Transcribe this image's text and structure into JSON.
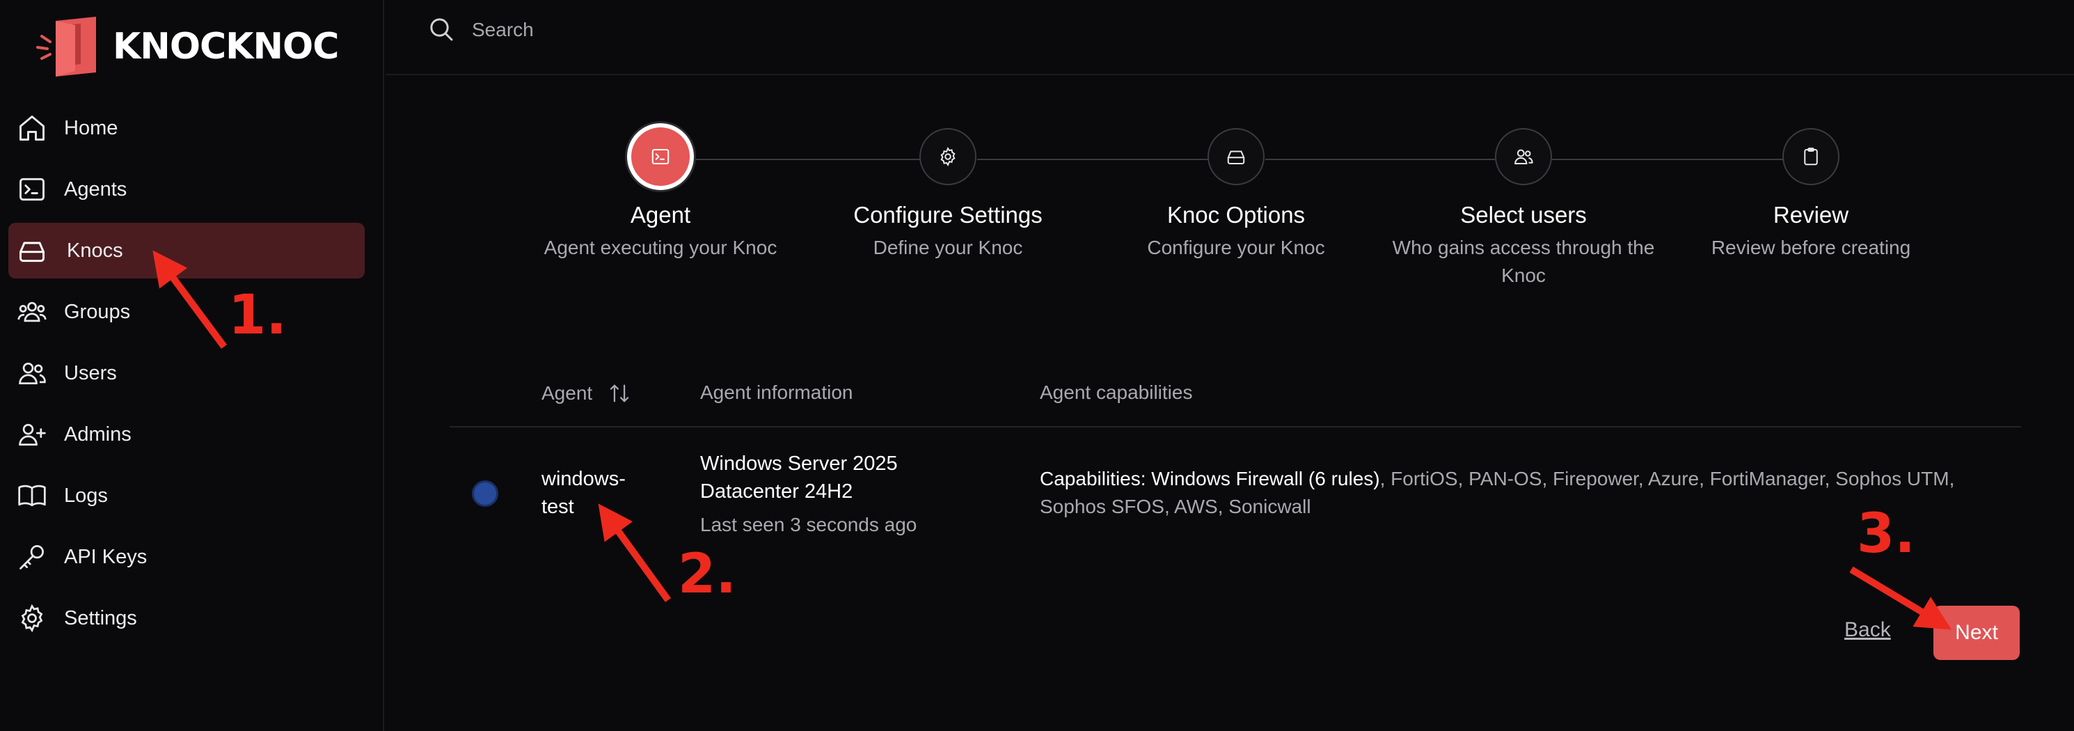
{
  "brand": {
    "name": "KNOCKNOC",
    "logo_icon": "knocknoc-door-logo",
    "accent": "#e05454"
  },
  "search": {
    "placeholder": "Search"
  },
  "sidebar": {
    "items": [
      {
        "label": "Home",
        "icon": "home-icon",
        "active": false
      },
      {
        "label": "Agents",
        "icon": "terminal-icon",
        "active": false
      },
      {
        "label": "Knocs",
        "icon": "drive-icon",
        "active": true
      },
      {
        "label": "Groups",
        "icon": "groups-icon",
        "active": false
      },
      {
        "label": "Users",
        "icon": "users-icon",
        "active": false
      },
      {
        "label": "Admins",
        "icon": "user-plus-icon",
        "active": false
      },
      {
        "label": "Logs",
        "icon": "book-icon",
        "active": false
      },
      {
        "label": "API Keys",
        "icon": "key-icon",
        "active": false
      },
      {
        "label": "Settings",
        "icon": "gear-icon",
        "active": false
      }
    ]
  },
  "stepper": {
    "steps": [
      {
        "title": "Agent",
        "subtitle": "Agent executing your Knoc",
        "icon": "terminal-icon",
        "active": true
      },
      {
        "title": "Configure Settings",
        "subtitle": "Define your Knoc",
        "icon": "gear-icon",
        "active": false
      },
      {
        "title": "Knoc Options",
        "subtitle": "Configure your Knoc",
        "icon": "drive-icon",
        "active": false
      },
      {
        "title": "Select users",
        "subtitle": "Who gains access through the Knoc",
        "icon": "users-icon",
        "active": false
      },
      {
        "title": "Review",
        "subtitle": "Review before creating",
        "icon": "clipboard-icon",
        "active": false
      }
    ]
  },
  "table": {
    "headers": {
      "agent": "Agent",
      "info": "Agent information",
      "capabilities": "Agent capabilities"
    },
    "rows": [
      {
        "selected": true,
        "name": "windows-test",
        "os": "Windows Server 2025 Datacenter 24H2",
        "last_seen": "Last seen 3 seconds ago",
        "capabilities_label": "Capabilities: Windows Firewall (6 rules)",
        "capabilities_rest": ", FortiOS, PAN-OS, Firepower, Azure, FortiManager, Sophos UTM, Sophos SFOS, AWS, Sonicwall"
      }
    ]
  },
  "actions": {
    "back": "Back",
    "next": "Next"
  },
  "annotations": {
    "step1": "1.",
    "step2": "2.",
    "step3": "3.",
    "color": "#ee2a1f"
  }
}
